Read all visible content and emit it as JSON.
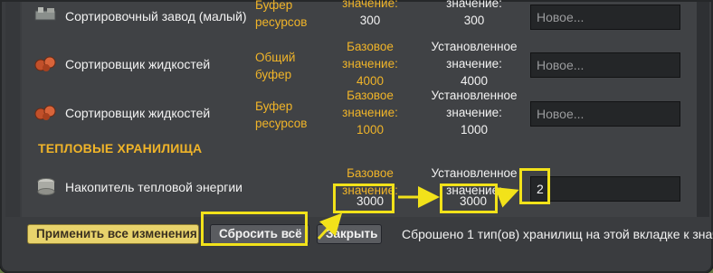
{
  "rows": [
    {
      "name": "Сортировочный завод (малый)",
      "type": "Буфер\nресурсов",
      "base_label": "значение:",
      "base_value": "300",
      "set_label": "значение:",
      "set_value": "300",
      "input_placeholder": "Новое...",
      "icon": "sorting-plant-icon"
    },
    {
      "name": "Сортировщик жидкостей",
      "type": "Общий\nбуфер",
      "base_label": "Базовое\nзначение:",
      "base_value": "4000",
      "set_label": "Установленное\nзначение:",
      "set_value": "4000",
      "input_placeholder": "Новое...",
      "icon": "liquid-sorter-icon"
    },
    {
      "name": "Сортировщик жидкостей",
      "type": "Буфер\nресурсов",
      "base_label": "Базовое\nзначение:",
      "base_value": "1000",
      "set_label": "Установленное\nзначение:",
      "set_value": "1000",
      "input_placeholder": "Новое...",
      "icon": "liquid-sorter-icon"
    }
  ],
  "section": {
    "title": "ТЕПЛОВЫЕ ХРАНИЛИЩА"
  },
  "thermal_row": {
    "name": "Накопитель тепловой энергии",
    "base_label": "Базовое\nзначение:",
    "base_value": "3000",
    "set_label": "Установленное\nзначение:",
    "set_value": "3000",
    "input_value": "2",
    "icon": "thermal-storage-icon"
  },
  "buttons": {
    "apply": "Применить все изменения",
    "reset": "Сбросить всё",
    "close": "Закрыть"
  },
  "status": "Сброшено 1 тип(ов) хранилищ на этой вкладке к знач",
  "colors": {
    "accent": "#f0b429",
    "highlight": "#f2e21a",
    "panel": "#3a3c3f"
  }
}
